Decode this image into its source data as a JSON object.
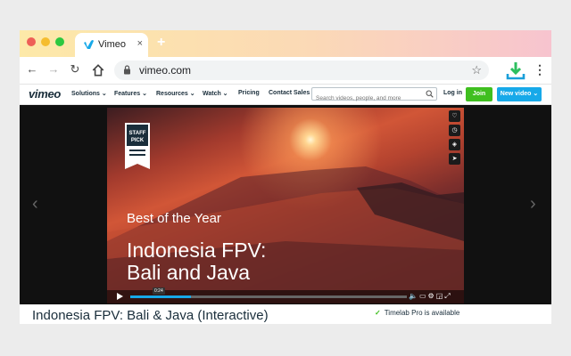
{
  "browser": {
    "tab_title": "Vimeo",
    "tab_close": "×",
    "new_tab": "+",
    "url": "vimeo.com",
    "traffic_lights": [
      "#ee5f57",
      "#f5bd2f",
      "#2dc840"
    ]
  },
  "vimeo_header": {
    "logo": "vimeo",
    "nav": [
      "Solutions ⌄",
      "Features ⌄",
      "Resources ⌄",
      "Watch ⌄",
      "Pricing",
      "Contact Sales"
    ],
    "search_placeholder": "Search videos, people, and more",
    "login": "Log in",
    "join": "Join",
    "new_video": "New video ⌄"
  },
  "player": {
    "badge_line1": "STAFF",
    "badge_line2": "PICK",
    "heading_small": "Best of the Year",
    "heading_large_line1": "Indonesia FPV:",
    "heading_large_line2": "Bali and Java",
    "time_badge": "0:24",
    "progress": 0.22,
    "left_arrow": "‹",
    "right_arrow": "›"
  },
  "below": {
    "video_title": "Indonesia FPV: Bali & Java (Interactive)",
    "timelab_check": "✓",
    "timelab_text": "Timelab Pro is available"
  }
}
